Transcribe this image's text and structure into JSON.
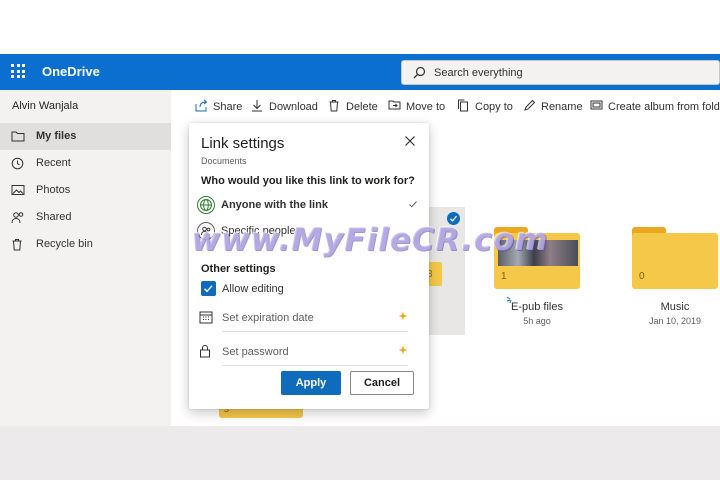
{
  "app": {
    "title": "OneDrive",
    "accent": "#0a6fcf"
  },
  "search": {
    "placeholder": "Search everything"
  },
  "sidebar": {
    "user": "Alvin Wanjala",
    "items": [
      {
        "label": "My files",
        "icon": "folder-icon",
        "active": true
      },
      {
        "label": "Recent",
        "icon": "clock-icon"
      },
      {
        "label": "Photos",
        "icon": "image-icon"
      },
      {
        "label": "Shared",
        "icon": "people-icon"
      },
      {
        "label": "Recycle bin",
        "icon": "trash-icon"
      }
    ]
  },
  "toolbar": {
    "share": "Share",
    "download": "Download",
    "delete": "Delete",
    "move_to": "Move to",
    "copy_to": "Copy to",
    "rename": "Rename",
    "create_album": "Create album from folde"
  },
  "dialog": {
    "title": "Link settings",
    "subtitle": "Documents",
    "question": "Who would you like this link to work for?",
    "options": [
      {
        "label": "Anyone with the link",
        "icon": "globe-icon",
        "selected": true
      },
      {
        "label": "Specific people",
        "icon": "people-icon",
        "selected": false
      }
    ],
    "other_settings": "Other settings",
    "allow_editing": "Allow editing",
    "allow_editing_checked": true,
    "expiration": "Set expiration date",
    "password": "Set password",
    "apply": "Apply",
    "cancel": "Cancel"
  },
  "files": [
    {
      "name": "E-pub files",
      "date": "5h ago",
      "count": "1"
    },
    {
      "name": "Music",
      "date": "Jan 10, 2019",
      "count": "0"
    }
  ],
  "peek_counts": {
    "middle": "8",
    "bottom": "3"
  },
  "watermark": "www.MyFileCR.com"
}
